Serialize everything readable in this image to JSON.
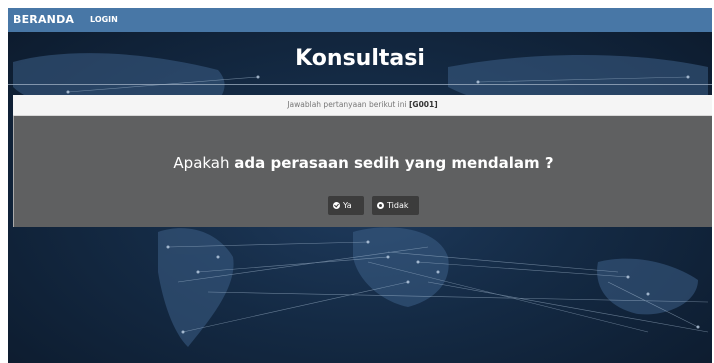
{
  "nav": {
    "brand": "BERANDA",
    "login": "LOGIN"
  },
  "page": {
    "title": "Konsultasi"
  },
  "panel": {
    "instruction": "Jawablah pertanyaan berikut ini",
    "code": "[G001]",
    "question_prefix": "Apakah",
    "question_bold": "ada perasaan sedih yang mendalam ?"
  },
  "buttons": {
    "yes": "Ya",
    "no": "Tidak"
  },
  "colors": {
    "navbar": "#4877a6",
    "panel_body": "#5f6061",
    "button": "#3c3c3c",
    "background": "#142a44"
  },
  "icons": {
    "yes": "check-circle",
    "no": "dot-circle"
  }
}
